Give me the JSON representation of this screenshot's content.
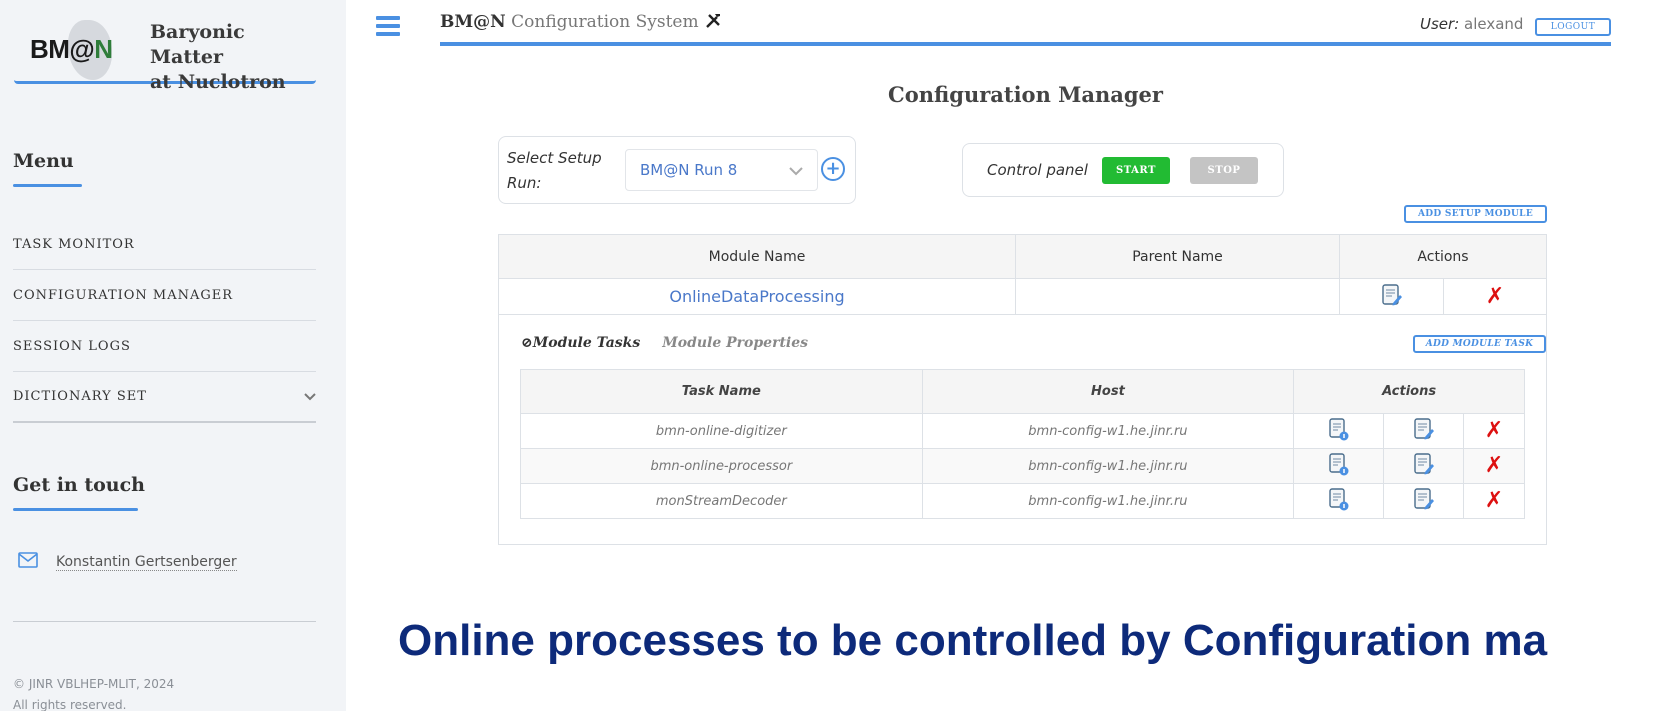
{
  "sidebar": {
    "brand": {
      "logo_text_a": "BM@",
      "logo_text_b": "N",
      "name_line1": "Baryonic Matter",
      "name_line2": "at Nuclotron"
    },
    "menu_heading": "Menu",
    "items": [
      {
        "label": "TASK MONITOR"
      },
      {
        "label": "CONFIGURATION MANAGER"
      },
      {
        "label": "SESSION LOGS"
      },
      {
        "label": "DICTIONARY SET",
        "has_submenu": true
      }
    ],
    "contact_heading": "Get in touch",
    "contact_name": "Konstantin Gertsenberger",
    "copyright_line1": "© JINR VBLHEP-MLIT, 2024",
    "copyright_line2": "All rights reserved."
  },
  "topbar": {
    "title_bold": "BM@N",
    "title_rest": " Configuration System",
    "user_label": "User:",
    "user_name": " alexand",
    "logout_label": "LOGOUT"
  },
  "page_title": "Configuration Manager",
  "setup": {
    "label_line1": "Select Setup",
    "label_line2": "Run:",
    "selected": "BM@N Run 8",
    "add_symbol": "+"
  },
  "control": {
    "label": "Control panel",
    "start_label": "START",
    "stop_label": "STOP"
  },
  "add_setup_module_label": "ADD SETUP MODULE",
  "module_table": {
    "headers": [
      "Module Name",
      "Parent Name",
      "Actions"
    ],
    "row": {
      "name": "OnlineDataProcessing",
      "parent": ""
    }
  },
  "module_tabs": {
    "active": "Module Tasks",
    "inactive": "Module Properties"
  },
  "add_module_task_label": "ADD MODULE TASK",
  "task_table": {
    "headers": [
      "Task Name",
      "Host",
      "Actions"
    ],
    "rows": [
      {
        "name": "bmn-online-digitizer",
        "host": "bmn-config-w1.he.jinr.ru"
      },
      {
        "name": "bmn-online-processor",
        "host": "bmn-config-w1.he.jinr.ru"
      },
      {
        "name": "monStreamDecoder",
        "host": "bmn-config-w1.he.jinr.ru"
      }
    ]
  },
  "banner": "Online processes to be controlled by Configuration ma",
  "colors": {
    "accent": "#4a90e2",
    "start": "#22bb33",
    "stop": "#c4c4c4",
    "delete": "#dd1111",
    "banner": "#0d2a7a"
  }
}
